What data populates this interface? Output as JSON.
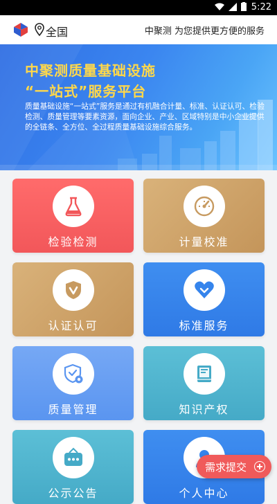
{
  "status_bar": {
    "time": "5:22"
  },
  "header": {
    "location": "全国",
    "slogan": "中聚测 为您提供更方便的服务"
  },
  "banner": {
    "title_line1": "中聚测质量基础设施",
    "title_line2": "“一站式”服务平台",
    "description": "质量基础设施“一站式”服务是通过有机融合计量、标准、认证认可、检验检测、质量管理等要素资源，面向企业、产业、区域特别是中小企业提供的全链条、全方位、全过程质量基础设施综合服务。"
  },
  "services": [
    {
      "label": "检验检测",
      "icon": "flask-icon"
    },
    {
      "label": "计量校准",
      "icon": "gauge-icon"
    },
    {
      "label": "认证认可",
      "icon": "shield-check-icon"
    },
    {
      "label": "标准服务",
      "icon": "heart-icon"
    },
    {
      "label": "质量管理",
      "icon": "badge-icon"
    },
    {
      "label": "知识产权",
      "icon": "book-icon"
    },
    {
      "label": "公示公告",
      "icon": "sign-icon"
    },
    {
      "label": "个人中心",
      "icon": "user-icon"
    }
  ],
  "fab": {
    "label": "需求提交"
  },
  "colors": {
    "accent_red": "#f05a5a",
    "banner_blue": "#3b86f0",
    "title_yellow": "#ffd84a"
  }
}
